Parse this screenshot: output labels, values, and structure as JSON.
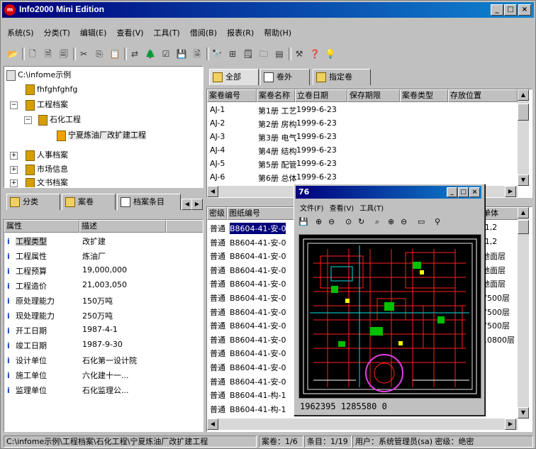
{
  "window": {
    "title": "Info2000 Mini Edition",
    "app_icon": "m"
  },
  "menubar": [
    "系统(S)",
    "分类(T)",
    "编辑(E)",
    "查看(V)",
    "工具(T)",
    "借阅(B)",
    "报表(R)",
    "帮助(H)"
  ],
  "tree": {
    "root": "C:\\infome示例",
    "nodes": [
      "fhfghfghfg",
      "工程档案",
      "石化工程",
      "宁夏炼油厂改扩建工程",
      "人事档案",
      "市场信息",
      "文书档案"
    ]
  },
  "left_tabs": [
    "分类",
    "案卷",
    "档案条目"
  ],
  "attr_table": {
    "headers": [
      "属性",
      "描述"
    ],
    "rows": [
      [
        "工程类型",
        "改扩建"
      ],
      [
        "工程属性",
        "炼油厂"
      ],
      [
        "工程预算",
        "19,000,000"
      ],
      [
        "工程造价",
        "21,003,050"
      ],
      [
        "原处理能力",
        "150万吨"
      ],
      [
        "现处理能力",
        "250万吨"
      ],
      [
        "开工日期",
        "1987-4-1"
      ],
      [
        "竣工日期",
        "1987-9-30"
      ],
      [
        "设计单位",
        "石化第一设计院"
      ],
      [
        "施工单位",
        "六化建十一..."
      ],
      [
        "监理单位",
        "石化监理公..."
      ]
    ]
  },
  "top_tabs": [
    "全部",
    "卷外",
    "指定卷"
  ],
  "volume_table": {
    "headers": [
      "案卷编号",
      "案卷名称",
      "立卷日期",
      "保存期限",
      "案卷类型",
      "存放位置"
    ],
    "rows": [
      [
        "AJ-1",
        "第1册 工艺",
        "1999-6-23"
      ],
      [
        "AJ-2",
        "第2册 房构",
        "1999-6-23"
      ],
      [
        "AJ-3",
        "第3册 电气",
        "1999-6-23"
      ],
      [
        "AJ-4",
        "第4册 结构",
        "1999-6-23"
      ],
      [
        "AJ-5",
        "第5册 配管",
        "1999-6-23"
      ],
      [
        "AJ-6",
        "第6册 总体",
        "1999-6-23"
      ]
    ]
  },
  "drawing_table": {
    "headers": [
      "密级",
      "图纸编号",
      "单体"
    ],
    "rows": [
      [
        "普通",
        "B8604-41-安-0",
        "/1,2"
      ],
      [
        "普通",
        "B8604-41-安-0",
        "/1,2"
      ],
      [
        "普通",
        "B8604-41-安-0",
        "地面层"
      ],
      [
        "普通",
        "B8604-41-安-0",
        "地面层"
      ],
      [
        "普通",
        "B8604-41-安-0",
        "地面层"
      ],
      [
        "普通",
        "B8604-41-安-0",
        "7500层"
      ],
      [
        "普通",
        "B8604-41-安-0",
        "7500层"
      ],
      [
        "普通",
        "B8604-41-安-0",
        "7500层"
      ],
      [
        "普通",
        "B8604-41-安-0",
        "10800层"
      ],
      [
        "普通",
        "B8604-41-安-0",
        ""
      ],
      [
        "普通",
        "B8604-41-安-0",
        ""
      ],
      [
        "普通",
        "B8604-41-安-0",
        ""
      ],
      [
        "普通",
        "B8604-41-构-1",
        ""
      ],
      [
        "普通",
        "B8604-41-构-1",
        ""
      ]
    ]
  },
  "viewer": {
    "title": "76",
    "menu": [
      "文件(F)",
      "查看(V)",
      "工具(T)"
    ],
    "coords": "1962395 1285580 0"
  },
  "status": {
    "path": "C:\\infome示例\\工程档案\\石化工程\\宁夏炼油厂改扩建工程",
    "volume": "案卷：1/6",
    "entry": "条目：1/19",
    "user": "用户：系统管理员(sa) 密级：绝密"
  }
}
